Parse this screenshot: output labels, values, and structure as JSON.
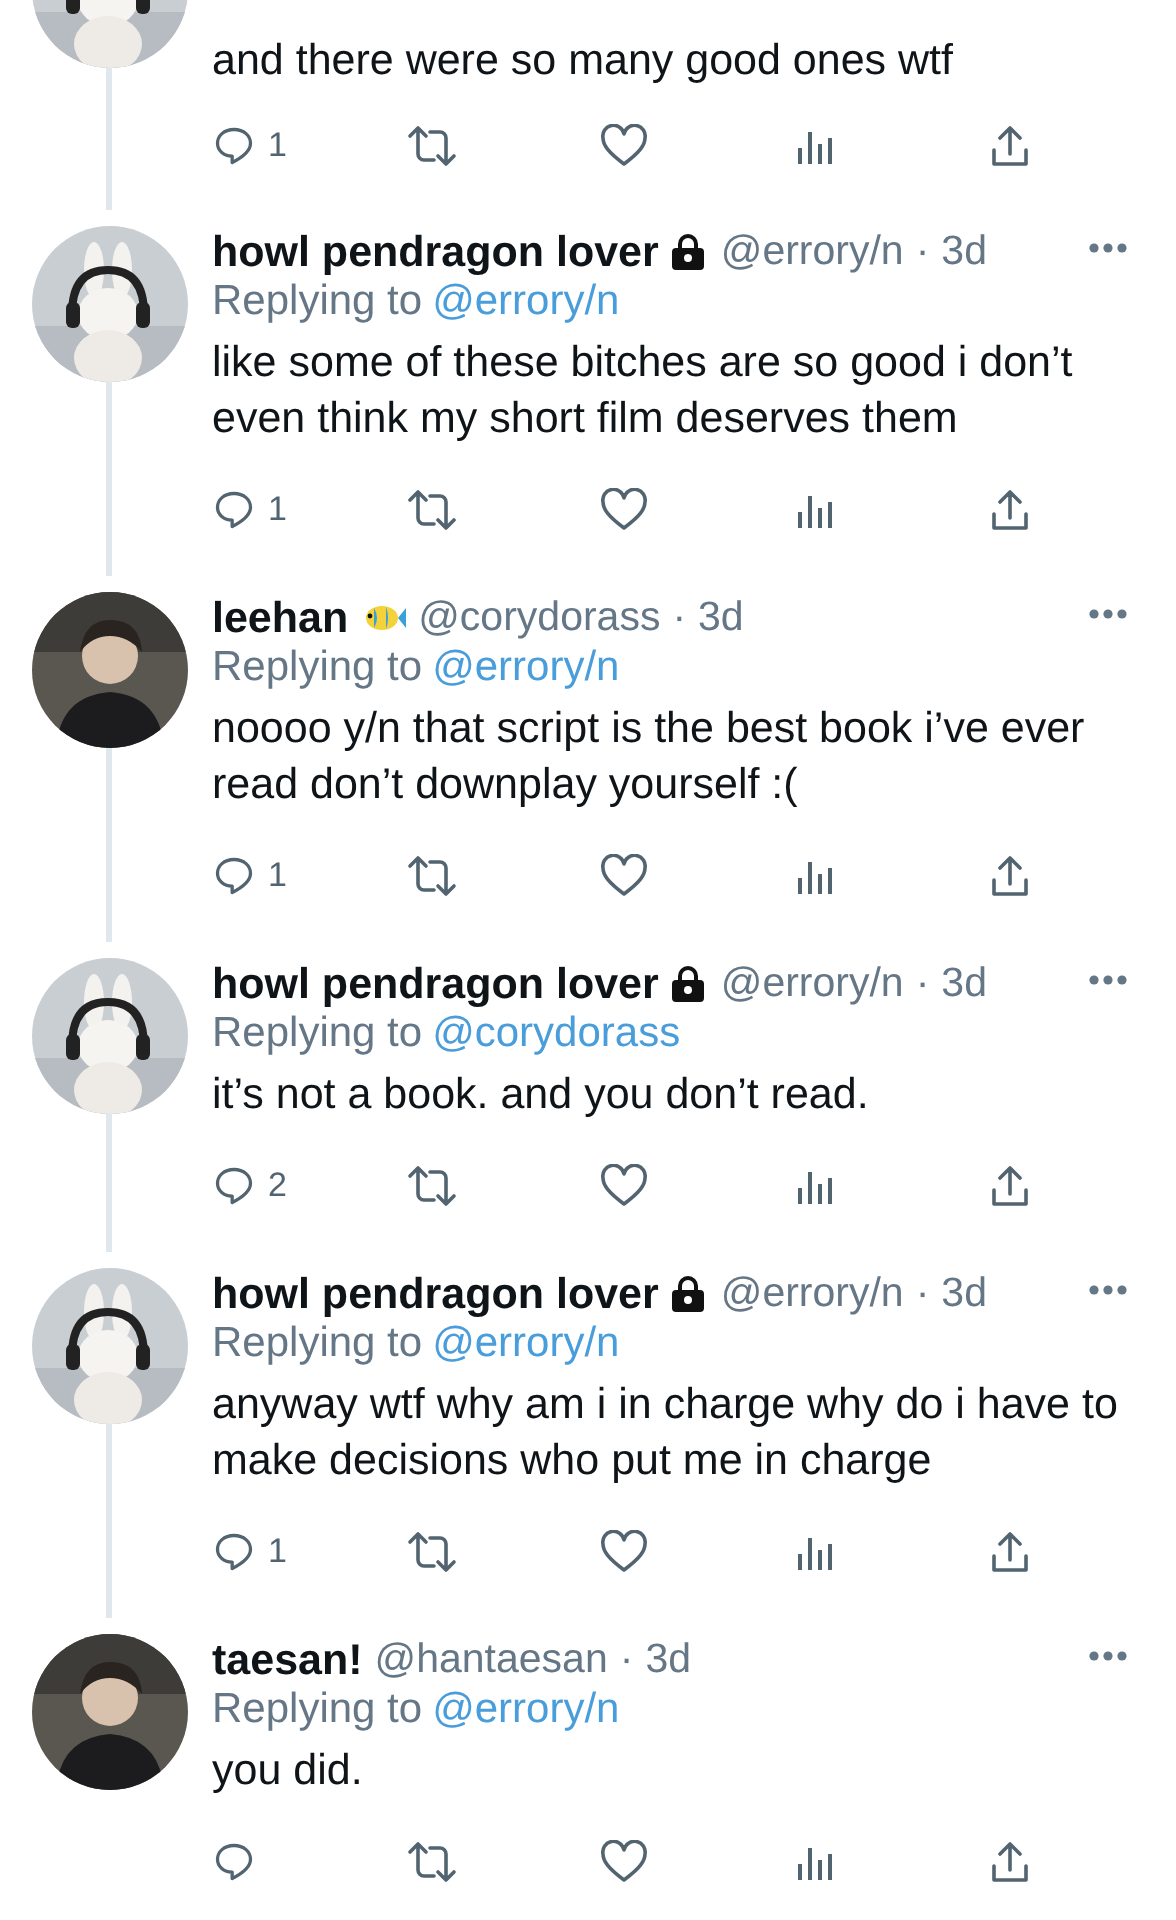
{
  "tweets": [
    {
      "cut_top": true,
      "text": "and there were so many good ones wtf",
      "replies": "1",
      "avatar": {
        "kind": "bunny"
      }
    },
    {
      "name": "howl pendragon lover",
      "badge": {
        "kind": "lock"
      },
      "handle": "@errory/n",
      "separator": "·",
      "time": "3d",
      "replying_label": "Replying to",
      "replying_to": "@errory/n",
      "text": "like some of these bitches are so good i don’t even think my short film deserves them",
      "replies": "1",
      "avatar": {
        "kind": "bunny"
      }
    },
    {
      "name": "leehan",
      "badge": {
        "kind": "fish"
      },
      "handle": "@corydorass",
      "separator": "·",
      "time": "3d",
      "replying_label": "Replying to",
      "replying_to": "@errory/n",
      "text": "noooo y/n that script is the best book i’ve ever read don’t downplay yourself :(",
      "replies": "1",
      "avatar": {
        "kind": "person"
      }
    },
    {
      "name": "howl pendragon lover",
      "badge": {
        "kind": "lock"
      },
      "handle": "@errory/n",
      "separator": "·",
      "time": "3d",
      "replying_label": "Replying to",
      "replying_to": "@corydorass",
      "text": "it’s not a book. and you don’t read.",
      "replies": "2",
      "avatar": {
        "kind": "bunny"
      }
    },
    {
      "name": "howl pendragon lover",
      "badge": {
        "kind": "lock"
      },
      "handle": "@errory/n",
      "separator": "·",
      "time": "3d",
      "replying_label": "Replying to",
      "replying_to": "@errory/n",
      "text": "anyway wtf why am i in charge why do  i  have to make decisions who put me in charge",
      "replies": "1",
      "avatar": {
        "kind": "bunny"
      }
    },
    {
      "name": "taesan!",
      "handle": "@hantaesan",
      "separator": "·",
      "time": "3d",
      "replying_label": "Replying to",
      "replying_to": "@errory/n",
      "text": "you did.",
      "avatar": {
        "kind": "person"
      }
    }
  ]
}
